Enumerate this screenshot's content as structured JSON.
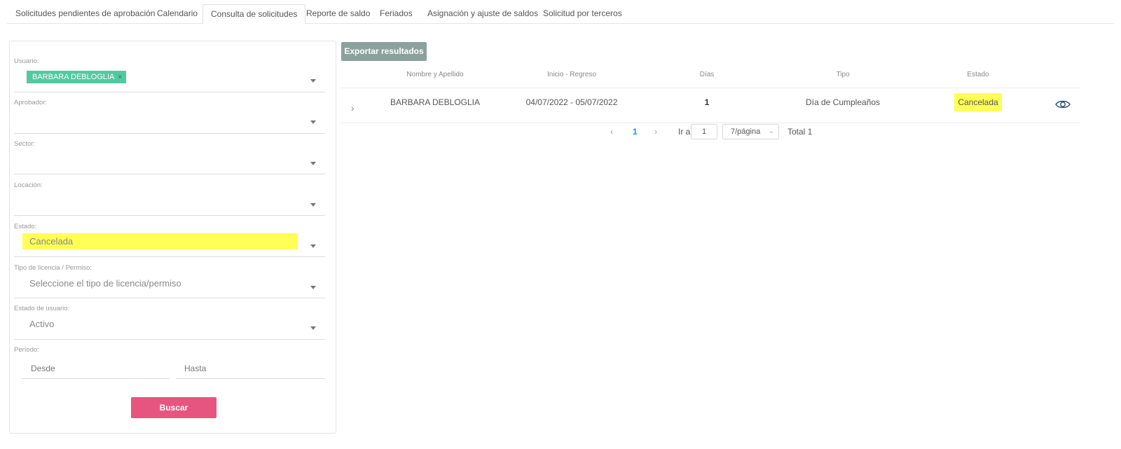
{
  "tabs": [
    {
      "label": "Solicitudes pendientes de aprobación"
    },
    {
      "label": "Calendario"
    },
    {
      "label": "Consulta de solicitudes",
      "active": true
    },
    {
      "label": "Reporte de saldo"
    },
    {
      "label": "Feriados"
    },
    {
      "label": "Asignación y ajuste de saldos"
    },
    {
      "label": "Solicitud por terceros"
    }
  ],
  "filters": {
    "usuario": {
      "label": "Usuario:",
      "tag": "BARBARA DEBLOGLIA",
      "tag_remove": "×"
    },
    "aprobador": {
      "label": "Aprobador:"
    },
    "sector": {
      "label": "Sector:"
    },
    "locacion": {
      "label": "Locación:"
    },
    "estado": {
      "label": "Estado:",
      "value": "Cancelada",
      "highlight_color": "#ffff55"
    },
    "tipo_licencia": {
      "label": "Tipo de licencia / Permiso:",
      "placeholder": "Seleccione el tipo de licencia/permiso"
    },
    "estado_usuario": {
      "label": "Estado de usuario:",
      "value": "Activo"
    },
    "periodo": {
      "label": "Período:",
      "desde_placeholder": "Desde",
      "hasta_placeholder": "Hasta"
    },
    "search_button": "Buscar"
  },
  "results": {
    "export_button": "Exportar resultados",
    "columns": [
      "Nombre y Apellido",
      "Inicio - Regreso",
      "Días",
      "Tipo",
      "Estado"
    ],
    "rows": [
      {
        "nombre": "BARBARA DEBLOGLIA",
        "fechas": "04/07/2022 - 05/07/2022",
        "dias": "1",
        "tipo": "Día de Cumpleaños",
        "estado": "Cancelada"
      }
    ],
    "icons": {
      "expand": "chevron-right-icon",
      "view": "eye-icon"
    }
  },
  "pagination": {
    "prev": "‹",
    "current_page": "1",
    "next": "›",
    "goto_label": "Ir a",
    "goto_value": "1",
    "page_size": "7/página",
    "total": "Total 1"
  },
  "colors": {
    "accent_button": "#e6557f",
    "export_button": "#8aa29b",
    "tag": "#52c9a0",
    "highlight": "#ffff55",
    "link": "#1890ff"
  }
}
